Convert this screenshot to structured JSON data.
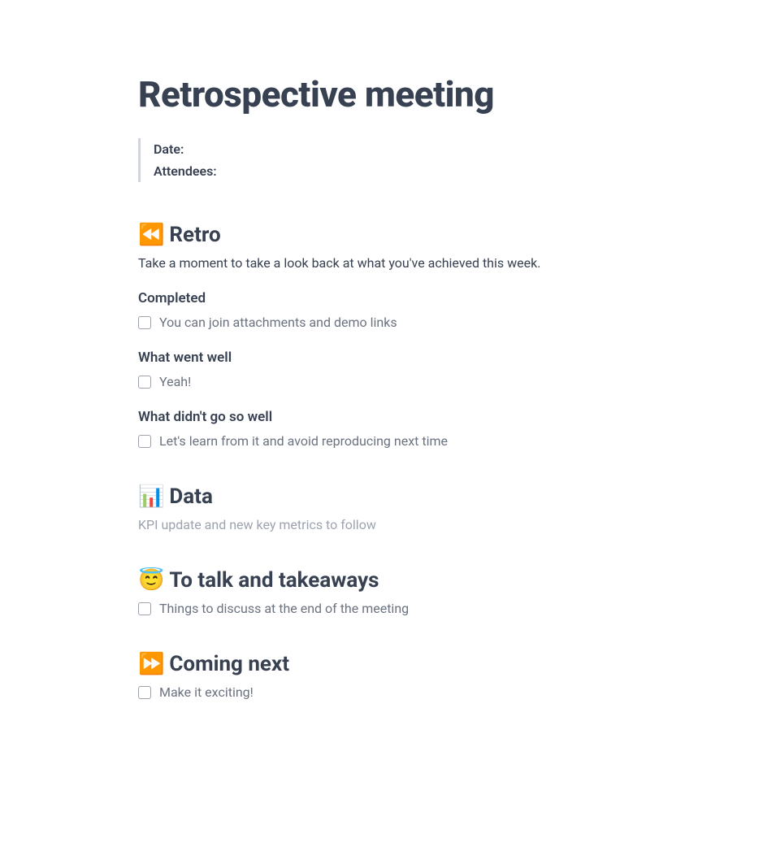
{
  "title": "Retrospective meeting",
  "meta": {
    "date_label": "Date:",
    "attendees_label": "Attendees:"
  },
  "sections": {
    "retro": {
      "emoji": "⏪",
      "heading": "Retro",
      "description": "Take a moment to take a look back at what you've achieved this week.",
      "subsections": {
        "completed": {
          "title": "Completed",
          "item": "You can join attachments and demo links"
        },
        "went_well": {
          "title": "What went well",
          "item": "Yeah!"
        },
        "didnt_go_well": {
          "title": "What didn't go so well",
          "item": "Let's learn from it and avoid reproducing next time"
        }
      }
    },
    "data": {
      "emoji": "📊",
      "heading": "Data",
      "description": "KPI update and new key metrics to follow"
    },
    "talk": {
      "emoji": "😇",
      "heading": "To talk and takeaways",
      "item": "Things to discuss at the end of the meeting"
    },
    "next": {
      "emoji": "⏩",
      "heading": "Coming next",
      "item": "Make it exciting!"
    }
  }
}
